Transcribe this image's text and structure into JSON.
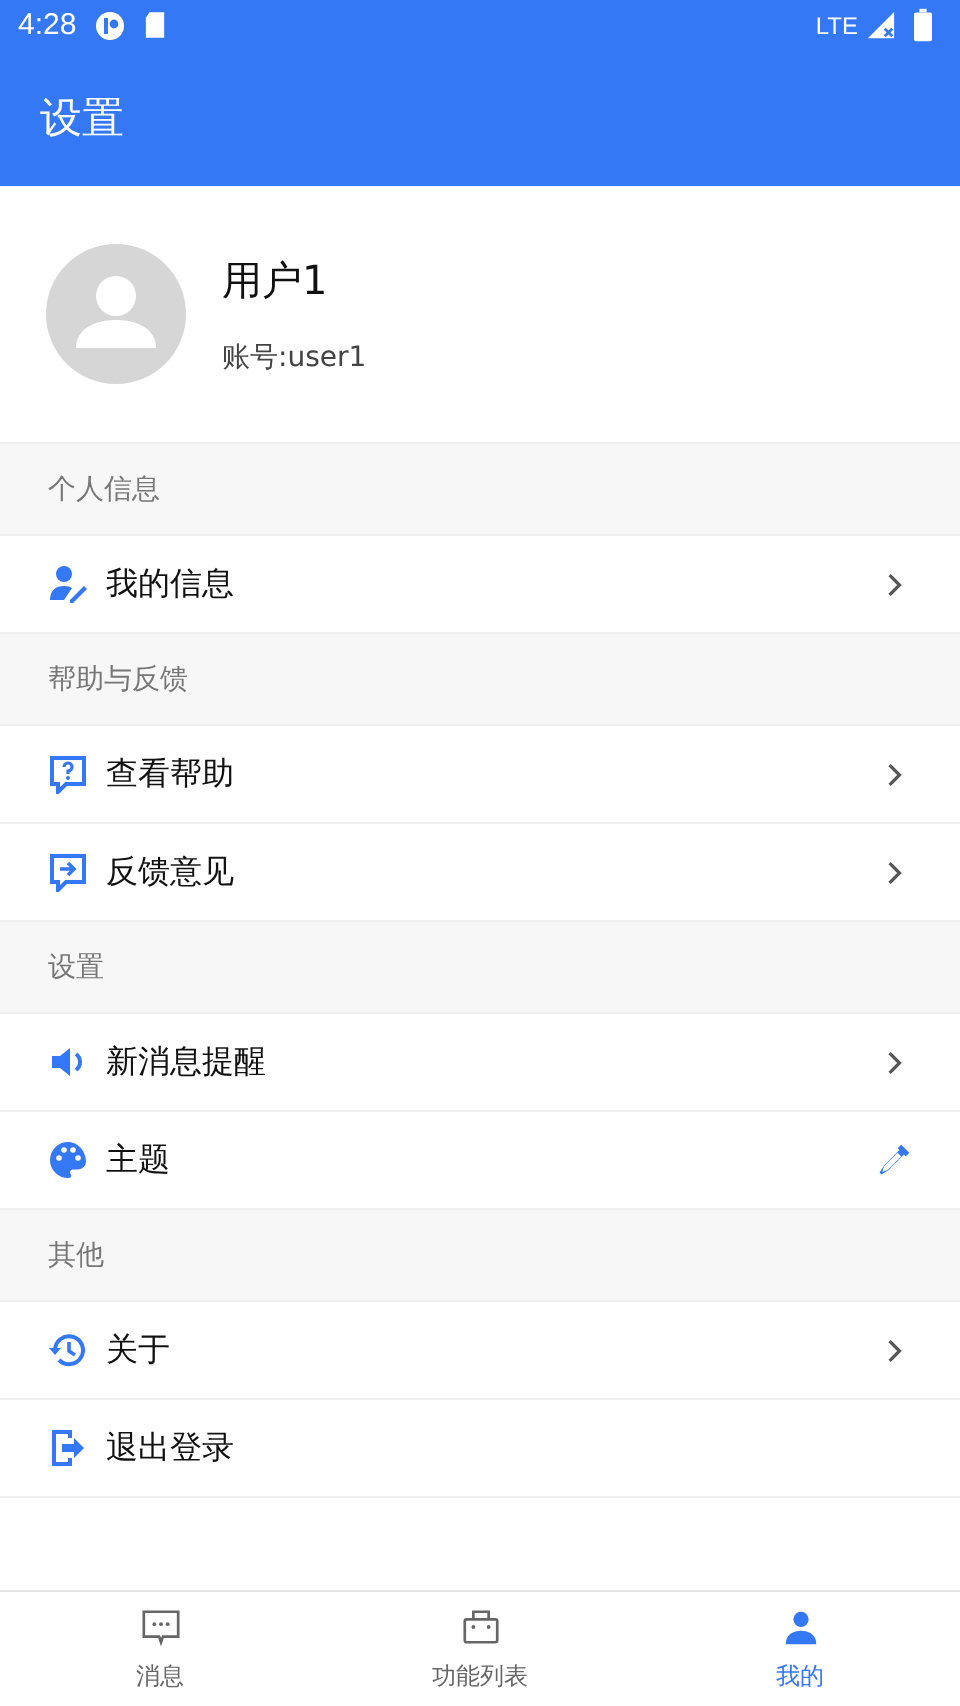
{
  "status_bar": {
    "time": "4:28",
    "network": "LTE"
  },
  "header": {
    "title": "设置"
  },
  "profile": {
    "name": "用户1",
    "account": "账号:user1"
  },
  "sections": [
    {
      "title": "个人信息",
      "items": [
        {
          "kind": "profile",
          "label": "我的信息"
        }
      ]
    },
    {
      "title": "帮助与反馈",
      "items": [
        {
          "kind": "help",
          "label": "查看帮助"
        },
        {
          "kind": "feedback",
          "label": "反馈意见"
        }
      ]
    },
    {
      "title": "设置",
      "items": [
        {
          "kind": "notify",
          "label": "新消息提醒"
        },
        {
          "kind": "theme",
          "label": "主题"
        }
      ]
    },
    {
      "title": "其他",
      "items": [
        {
          "kind": "about",
          "label": "关于"
        },
        {
          "kind": "logout",
          "label": "退出登录"
        }
      ]
    }
  ],
  "tabs": [
    {
      "kind": "messages",
      "label": "消息",
      "selected": false
    },
    {
      "kind": "features",
      "label": "功能列表",
      "selected": false
    },
    {
      "kind": "mine",
      "label": "我的",
      "selected": true
    }
  ]
}
